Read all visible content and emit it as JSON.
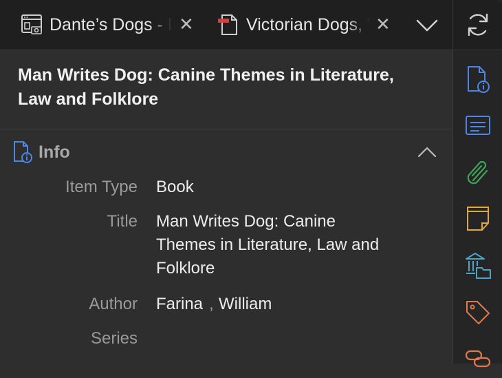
{
  "tabs": [
    {
      "label": "Dante’s Dogs - Dante Studies",
      "icon": "web-snapshot-icon"
    },
    {
      "label": "Victorian Dogs, Victorian Men",
      "icon": "pdf-document-icon"
    }
  ],
  "header": {
    "title": "Man Writes Dog: Canine Themes in Literature, Law and Folklore"
  },
  "info_section": {
    "title": "Info",
    "fields": {
      "item_type_label": "Item Type",
      "item_type_value": "Book",
      "title_label": "Title",
      "title_value": "Man Writes Dog: Canine Themes in Literature, Law and Folklore",
      "author_label": "Author",
      "author_last": "Farina",
      "author_first": "William",
      "series_label": "Series"
    }
  },
  "side_nav": [
    "refresh-icon",
    "info-icon",
    "abstract-icon",
    "attachments-icon",
    "notes-icon",
    "libraries-collections-icon",
    "tags-icon",
    "related-icon"
  ],
  "colors": {
    "accent_blue": "#4e86e6",
    "green": "#3fa35a",
    "yellow": "#e0a93a",
    "orange": "#e07a4a"
  }
}
